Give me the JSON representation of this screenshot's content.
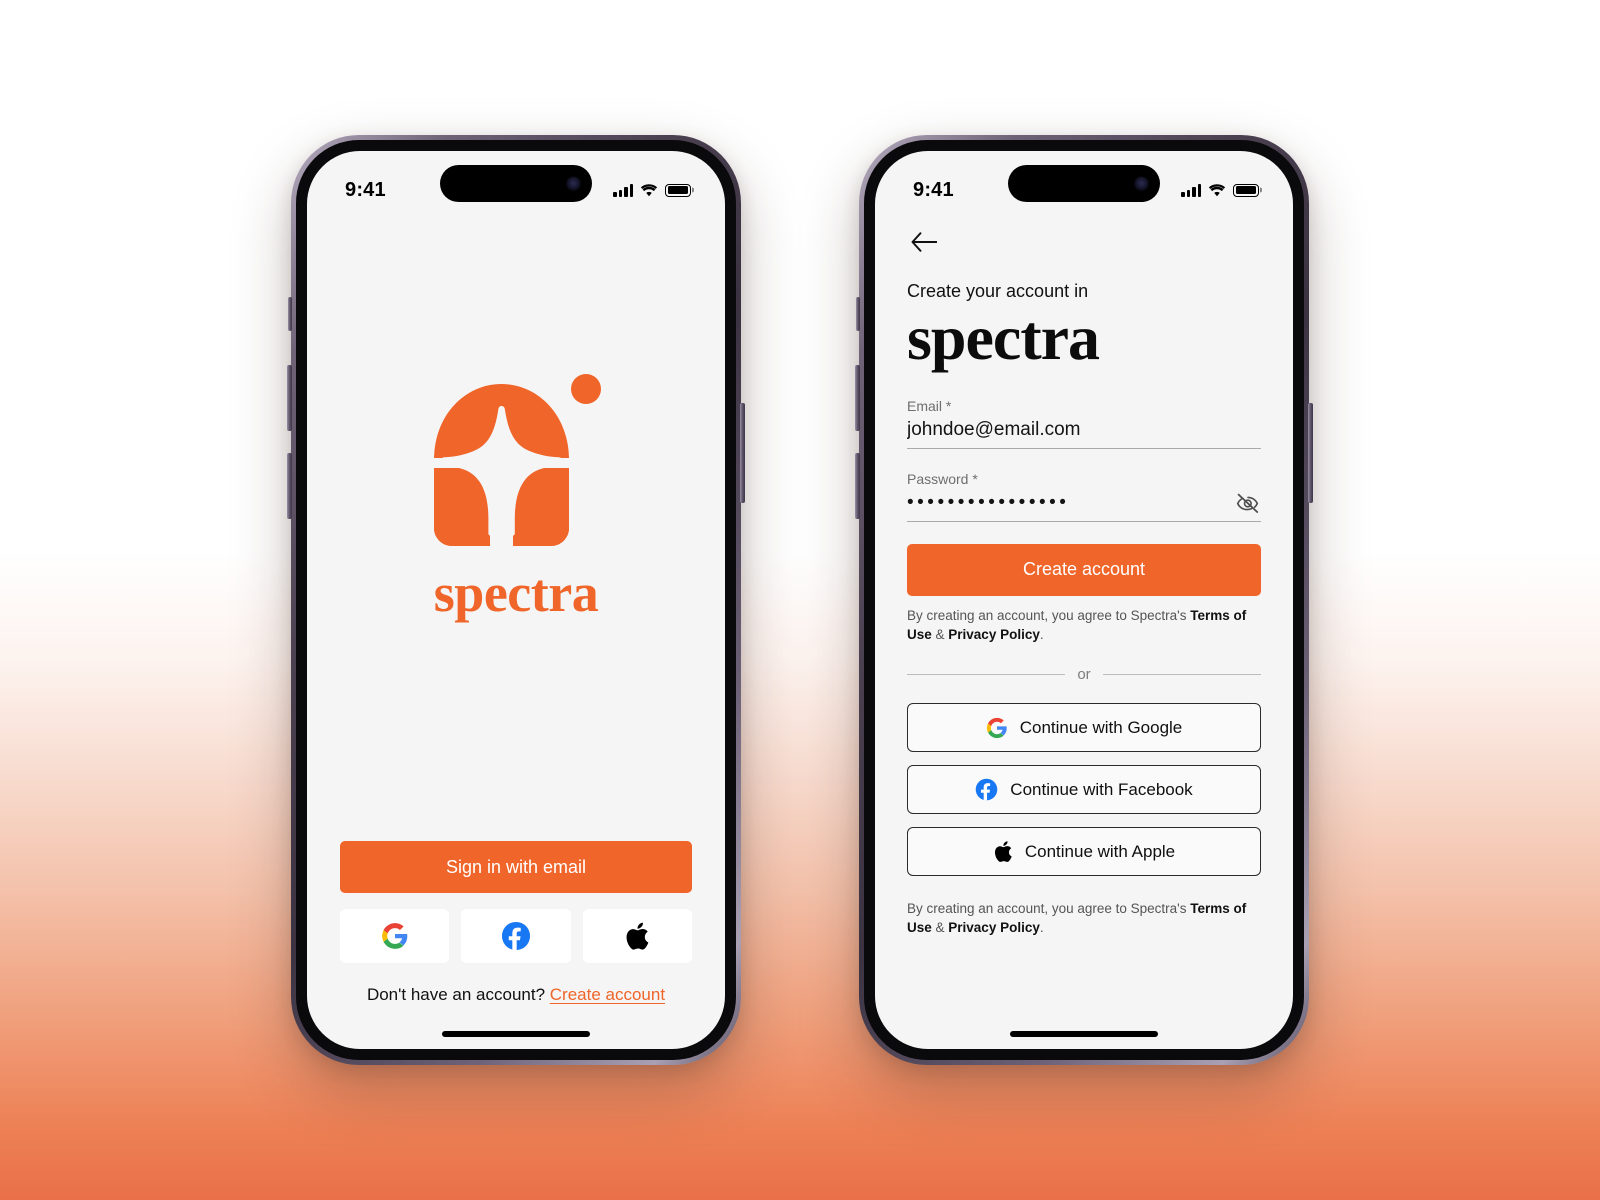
{
  "brand": {
    "name": "spectra",
    "accent_color": "#f06529",
    "screen_bg": "#f5f5f5"
  },
  "background": {
    "top_color": "#ffffff",
    "bottom_color": "#ea7048"
  },
  "status_bar": {
    "time": "9:41",
    "signal_icon": "cellular-signal-icon",
    "wifi_icon": "wifi-icon",
    "battery_icon": "battery-full-icon"
  },
  "screen_one": {
    "logo_icon": "spectra-logo-mark",
    "wordmark": "spectra",
    "primary_button": "Sign in with email",
    "social_buttons": [
      {
        "icon": "google-icon",
        "name": "Google"
      },
      {
        "icon": "facebook-icon",
        "name": "Facebook"
      },
      {
        "icon": "apple-icon",
        "name": "Apple"
      }
    ],
    "footer_prompt": "Don't have an account?",
    "footer_link": "Create account"
  },
  "screen_two": {
    "back_icon": "arrow-left-icon",
    "kicker": "Create your account in",
    "wordmark": "spectra",
    "email_field": {
      "label": "Email *",
      "value": "johndoe@email.com",
      "placeholder": "johndoe@email.com"
    },
    "password_field": {
      "label": "Password *",
      "value": "••••••••••••••••",
      "placeholder": "Password",
      "toggle_icon": "eye-off-icon"
    },
    "primary_button": "Create account",
    "terms": {
      "lead": "By creating an account, you agree to Spectra's ",
      "terms_link": "Terms of Use",
      "conjunction": " & ",
      "privacy_link": "Privacy Policy",
      "trailing": "."
    },
    "divider_text": "or",
    "oauth_buttons": [
      {
        "icon": "google-icon",
        "label": "Continue with Google"
      },
      {
        "icon": "facebook-icon",
        "label": "Continue with Facebook"
      },
      {
        "icon": "apple-icon",
        "label": "Continue with Apple"
      }
    ]
  }
}
